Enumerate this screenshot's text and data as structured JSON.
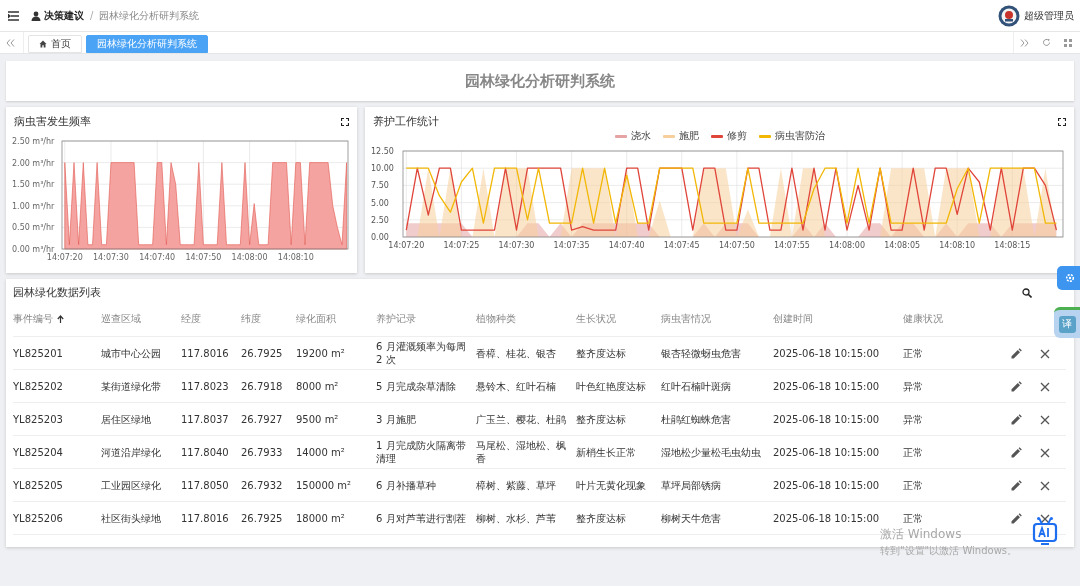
{
  "header": {
    "breadcrumb": [
      {
        "label": "决策建议",
        "current": false
      },
      {
        "label": "园林绿化分析研判系统",
        "current": true
      }
    ],
    "separator": "/",
    "user": "超级管理员"
  },
  "tabs": [
    {
      "label": "首页",
      "kind": "home",
      "selected": false
    },
    {
      "label": "园林绿化分析研判系统",
      "kind": "page",
      "selected": true
    }
  ],
  "page_title": "园林绿化分析研判系统",
  "pest_chart": {
    "title": "病虫害发生频率",
    "chart_data": {
      "type": "area",
      "categories": [
        "14:07:20",
        null,
        null,
        null,
        null,
        null,
        null,
        null,
        null,
        null,
        "14:07:30",
        null,
        null,
        null,
        null,
        null,
        null,
        null,
        null,
        null,
        "14:07:40",
        null,
        null,
        null,
        null,
        null,
        null,
        null,
        null,
        null,
        "14:07:50",
        null,
        null,
        null,
        null,
        null,
        null,
        null,
        null,
        null,
        "14:08:00",
        null,
        null,
        null,
        null,
        null,
        null,
        null,
        null,
        null,
        "14:08:10",
        null,
        null,
        null,
        null,
        null,
        null,
        null,
        null,
        null,
        null,
        null
      ],
      "values": [
        2,
        0.1,
        2,
        0.1,
        2,
        0.1,
        0.1,
        2,
        0.1,
        0.1,
        2,
        2,
        2,
        2,
        2,
        2,
        0.1,
        0.1,
        0.1,
        0.1,
        2,
        2,
        0.1,
        2,
        1.5,
        0.1,
        0.1,
        0.1,
        0.1,
        2,
        0.1,
        0.1,
        0.1,
        0.1,
        2,
        0.1,
        0.1,
        0.1,
        0.1,
        2,
        0.1,
        1.05,
        0.1,
        0.1,
        0.1,
        2,
        2,
        2,
        2,
        0.1,
        2,
        2,
        0.1,
        2,
        2,
        2,
        2,
        2,
        1,
        0.5,
        0.1,
        2
      ],
      "ylim": [
        0,
        2.5
      ],
      "grid": true,
      "yticks": [
        {
          "value": 0,
          "label": "0.00 m³/hr"
        },
        {
          "value": 0.5,
          "label": "0.50 m³/hr"
        },
        {
          "value": 1,
          "label": "1.00 m³/hr"
        },
        {
          "value": 1.5,
          "label": "1.50 m³/hr"
        },
        {
          "value": 2,
          "label": "2.00 m³/hr"
        },
        {
          "value": 2.5,
          "label": "2.50 m³/hr"
        }
      ]
    }
  },
  "care_chart": {
    "title": "养护工作统计",
    "chart_data": {
      "type": "line",
      "categories": [
        "14:07:20",
        null,
        null,
        null,
        null,
        "14:07:25",
        null,
        null,
        null,
        null,
        "14:07:30",
        null,
        null,
        null,
        null,
        "14:07:35",
        null,
        null,
        null,
        null,
        "14:07:40",
        null,
        null,
        null,
        null,
        "14:07:45",
        null,
        null,
        null,
        null,
        "14:07:50",
        null,
        null,
        null,
        null,
        "14:07:55",
        null,
        null,
        null,
        null,
        "14:08:00",
        null,
        null,
        null,
        null,
        "14:08:05",
        null,
        null,
        null,
        null,
        "14:08:10",
        null,
        null,
        null,
        null,
        "14:08:15",
        null,
        null,
        null,
        null
      ],
      "series": [
        {
          "name": "浇水",
          "color": "#e6a3a3",
          "type": "area",
          "values": [
            2,
            2,
            2,
            2,
            2,
            2,
            0,
            0,
            0,
            0,
            0,
            2,
            2,
            0,
            2,
            0,
            2,
            2,
            2,
            2,
            2,
            2,
            2,
            0,
            0,
            0,
            0,
            2,
            0,
            2,
            2,
            2,
            0,
            0,
            0,
            0,
            2,
            0,
            2,
            0,
            0,
            0,
            2,
            2,
            0,
            2,
            2,
            0,
            0,
            2,
            0,
            2,
            2,
            2,
            0,
            2,
            2,
            2,
            2,
            2
          ]
        },
        {
          "name": "施肥",
          "color": "#f7cf9c",
          "type": "area",
          "values": [
            0,
            0,
            10,
            0,
            10,
            0,
            0,
            10,
            0,
            10,
            10,
            10,
            0,
            0,
            0,
            10,
            10,
            10,
            10,
            0,
            10,
            0,
            0,
            5.3,
            0,
            0,
            0,
            10,
            10,
            10,
            0,
            4,
            0,
            0,
            10,
            0,
            10,
            10,
            0,
            0,
            0,
            0,
            0,
            0,
            10,
            10,
            10,
            10,
            0,
            10,
            10,
            10,
            0,
            0,
            10,
            10,
            10,
            0,
            10,
            0
          ]
        },
        {
          "name": "修剪",
          "color": "#e0453a",
          "values": [
            1,
            10,
            3.2,
            10,
            10,
            1,
            1,
            1,
            1,
            10,
            1,
            10,
            10,
            10,
            10,
            1,
            1.5,
            1,
            1,
            1,
            10,
            10,
            1,
            10,
            10,
            10,
            1,
            10,
            10,
            1,
            1,
            10,
            10,
            1,
            1,
            10,
            1,
            10,
            1,
            10,
            1,
            7.5,
            1,
            10,
            1,
            1,
            10,
            1,
            10,
            10,
            3.3,
            10,
            8,
            1,
            10,
            1,
            10,
            10,
            7.5,
            1
          ]
        },
        {
          "name": "病虫害防治",
          "color": "#f2b705",
          "values": [
            10,
            10,
            10,
            6,
            3.6,
            8,
            10,
            2,
            10,
            10,
            10,
            2.5,
            10,
            2,
            2,
            2,
            10,
            2,
            10,
            2,
            9,
            2,
            2,
            10,
            10,
            10,
            10,
            2,
            2,
            2,
            2,
            10,
            2,
            2,
            2,
            2,
            2,
            7,
            10,
            10,
            2,
            10,
            2,
            10,
            2,
            2,
            2,
            2,
            2,
            2,
            7,
            10,
            2,
            10,
            10,
            10,
            10,
            10,
            2,
            2
          ]
        }
      ],
      "ylim": [
        0,
        12.5
      ],
      "grid": true,
      "yticks": [
        {
          "value": 0,
          "label": "0.00"
        },
        {
          "value": 2.5,
          "label": "2.50"
        },
        {
          "value": 5,
          "label": "5.00"
        },
        {
          "value": 7.5,
          "label": "7.50"
        },
        {
          "value": 10,
          "label": "10.00"
        },
        {
          "value": 12.5,
          "label": "12.50"
        }
      ]
    }
  },
  "table": {
    "title": "园林绿化数据列表",
    "columns": [
      {
        "label": "事件编号",
        "sorted": true
      },
      {
        "label": "巡查区域",
        "sorted": false
      },
      {
        "label": "经度",
        "sorted": false
      },
      {
        "label": "纬度",
        "sorted": false
      },
      {
        "label": "绿化面积",
        "sorted": false
      },
      {
        "label": "养护记录",
        "sorted": false
      },
      {
        "label": "植物种类",
        "sorted": false
      },
      {
        "label": "生长状况",
        "sorted": false
      },
      {
        "label": "病虫害情况",
        "sorted": false
      },
      {
        "label": "创建时间",
        "sorted": false
      },
      {
        "label": "健康状况",
        "sorted": false
      }
    ],
    "rows": [
      [
        "YL825201",
        "城市中心公园",
        "117.8016",
        "26.7925",
        "19200 m²",
        "6 月灌溉频率为每周 2 次",
        "香樟、桂花、银杏",
        "整齐度达标",
        "银杏轻微蚜虫危害",
        "2025-06-18 10:15:00",
        "正常"
      ],
      [
        "YL825202",
        "某街道绿化带",
        "117.8023",
        "26.7918",
        "8000 m²",
        "5 月完成杂草清除",
        "悬铃木、红叶石楠",
        "叶色红艳度达标",
        "红叶石楠叶斑病",
        "2025-06-18 10:15:00",
        "异常"
      ],
      [
        "YL825203",
        "居住区绿地",
        "117.8037",
        "26.7927",
        "9500 m²",
        "3 月施肥",
        "广玉兰、樱花、杜鹃",
        "整齐度达标",
        "杜鹃红蜘蛛危害",
        "2025-06-18 10:15:00",
        "异常"
      ],
      [
        "YL825204",
        "河道沿岸绿化",
        "117.8040",
        "26.7933",
        "14000 m²",
        "1 月完成防火隔离带清理",
        "马尾松、湿地松、枫香",
        "新梢生长正常",
        "湿地松少量松毛虫幼虫",
        "2025-06-18 10:15:00",
        "正常"
      ],
      [
        "YL825205",
        "工业园区绿化",
        "117.8050",
        "26.7932",
        "150000 m²",
        "6 月补播草种",
        "樟树、紫藤、草坪",
        "叶片无黄化现象",
        "草坪局部锈病",
        "2025-06-18 10:15:00",
        "正常"
      ],
      [
        "YL825206",
        "社区街头绿地",
        "117.8016",
        "26.7925",
        "18000 m²",
        "6 月对芦苇进行割茬",
        "柳树、水杉、芦苇",
        "整齐度达标",
        "柳树天牛危害",
        "2025-06-18 10:15:00",
        "正常"
      ]
    ]
  },
  "translate_button": "译",
  "os_notice": {
    "title": "激活 Windows",
    "hint": "转到\"设置\"以激活 Windows。"
  }
}
